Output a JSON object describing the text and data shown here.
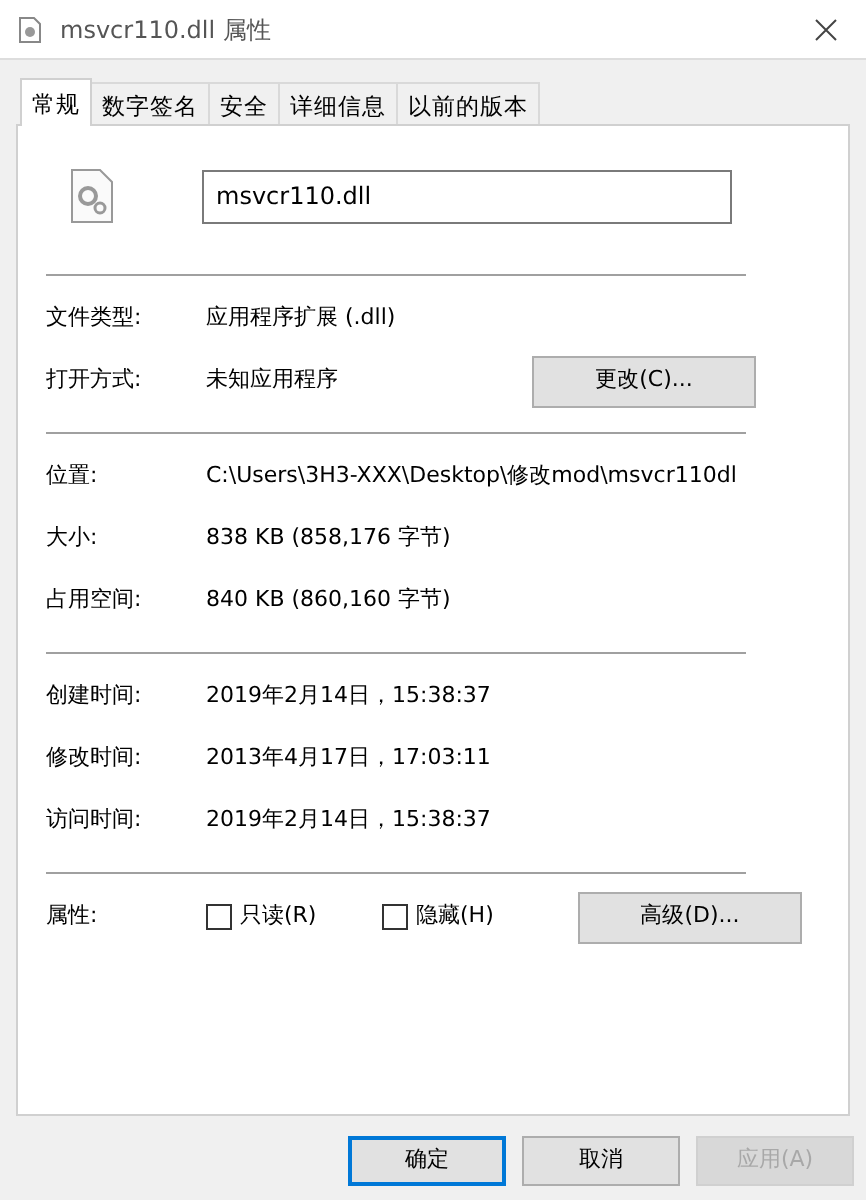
{
  "window": {
    "title": "msvcr110.dll 属性"
  },
  "tabs": [
    {
      "label": "常规",
      "selected": true
    },
    {
      "label": "数字签名",
      "selected": false
    },
    {
      "label": "安全",
      "selected": false
    },
    {
      "label": "详细信息",
      "selected": false
    },
    {
      "label": "以前的版本",
      "selected": false
    }
  ],
  "file_name": "msvcr110.dll",
  "sections": [
    [
      {
        "label": "文件类型:",
        "value": "应用程序扩展 (.dll)"
      },
      {
        "label": "打开方式:",
        "value": "未知应用程序",
        "button": "更改(C)..."
      }
    ],
    [
      {
        "label": "位置:",
        "value": "C:\\Users\\3H3-XXX\\Desktop\\修改mod\\msvcr110dl"
      },
      {
        "label": "大小:",
        "value": "838 KB (858,176 字节)"
      },
      {
        "label": "占用空间:",
        "value": "840 KB (860,160 字节)"
      }
    ],
    [
      {
        "label": "创建时间:",
        "value": "2019年2月14日，15:38:37"
      },
      {
        "label": "修改时间:",
        "value": "2013年4月17日，17:03:11"
      },
      {
        "label": "访问时间:",
        "value": "2019年2月14日，15:38:37"
      }
    ]
  ],
  "attributes": {
    "label": "属性:",
    "checkboxes": [
      {
        "label": "只读(R)",
        "checked": false
      },
      {
        "label": "隐藏(H)",
        "checked": false
      }
    ],
    "button": "高级(D)..."
  },
  "buttons": [
    {
      "label": "确定",
      "kind": "default",
      "disabled": false
    },
    {
      "label": "取消",
      "kind": "normal",
      "disabled": false
    },
    {
      "label": "应用(A)",
      "kind": "normal",
      "disabled": true
    }
  ]
}
